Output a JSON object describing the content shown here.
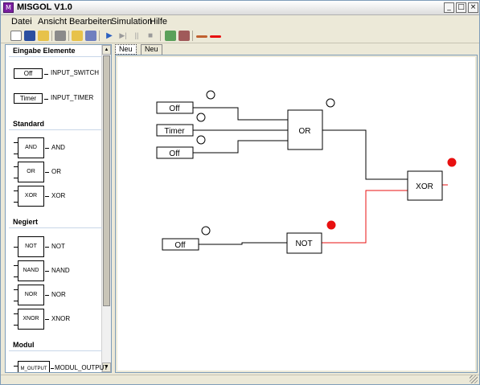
{
  "window": {
    "title": "MISGOL V1.0",
    "icon_text": "M",
    "buttons": {
      "minimize": "_",
      "maximize": "□",
      "close": "×"
    }
  },
  "menu": {
    "items": [
      "Datei",
      "Ansicht",
      "Bearbeiten",
      "Simulation",
      "Hilfe"
    ]
  },
  "toolbar": {
    "icons": [
      "new-file-icon",
      "save-icon",
      "open-folder-icon",
      "print-icon",
      "open-icon",
      "export-icon",
      "play-icon",
      "step-icon",
      "pause-icon",
      "stop-icon",
      "zoom-in-icon",
      "zoom-out-icon",
      "wire-icon",
      "wire-red-icon"
    ]
  },
  "palette": {
    "sections": [
      {
        "title": "Eingabe Elemente",
        "items": [
          {
            "box": "Off",
            "label": "INPUT_SWITCH"
          },
          {
            "box": "Timer",
            "label": "INPUT_TIMER"
          }
        ]
      },
      {
        "title": "Standard",
        "items": [
          {
            "box": "AND",
            "label": "AND"
          },
          {
            "box": "OR",
            "label": "OR"
          },
          {
            "box": "XOR",
            "label": "XOR"
          }
        ]
      },
      {
        "title": "Negiert",
        "items": [
          {
            "box": "NOT",
            "label": "NOT"
          },
          {
            "box": "NAND",
            "label": "NAND"
          },
          {
            "box": "NOR",
            "label": "NOR"
          },
          {
            "box": "XNOR",
            "label": "XNOR"
          }
        ]
      },
      {
        "title": "Modul",
        "items": [
          {
            "box": "M_OUTPUT",
            "label": "MODUL_OUTPUT"
          }
        ]
      }
    ],
    "scroll": {
      "up": "▲",
      "down": "▼"
    }
  },
  "tabs": [
    {
      "label": "Neu",
      "active": true
    },
    {
      "label": "Neu",
      "active": false
    }
  ],
  "circuit": {
    "inputs": [
      {
        "label": "Off"
      },
      {
        "label": "Timer"
      },
      {
        "label": "Off"
      },
      {
        "label": "Off"
      }
    ],
    "gates": [
      {
        "label": "OR"
      },
      {
        "label": "XOR"
      },
      {
        "label": "NOT"
      }
    ],
    "colors": {
      "active": "#e81010",
      "wire": "#000000",
      "active_wire": "#e81010"
    }
  }
}
